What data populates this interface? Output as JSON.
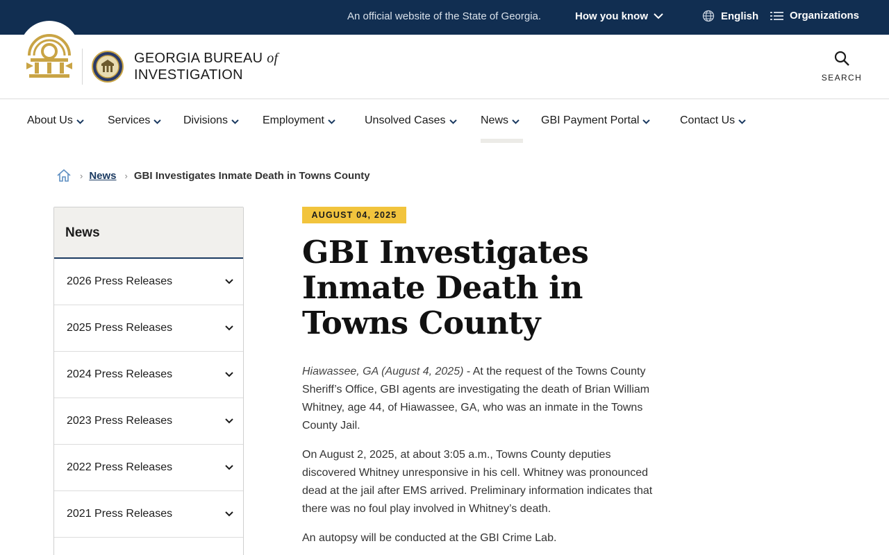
{
  "banner": {
    "official_text": "An official website of the State of Georgia.",
    "how_you_know": "How you know",
    "language": "English",
    "organizations": "Organizations"
  },
  "header": {
    "agency_line1_prefix": "GEORGIA BUREAU",
    "agency_line1_of": "of",
    "agency_line2": "INVESTIGATION",
    "search_label": "SEARCH"
  },
  "nav": {
    "items": [
      {
        "label": "About Us"
      },
      {
        "label": "Services"
      },
      {
        "label": "Divisions"
      },
      {
        "label": "Employment"
      },
      {
        "label": "Unsolved Cases"
      },
      {
        "label": "News"
      },
      {
        "label": "GBI Payment Portal"
      },
      {
        "label": "Contact Us"
      }
    ],
    "active": "News"
  },
  "breadcrumb": {
    "section": "News",
    "current": "GBI Investigates Inmate Death in Towns County"
  },
  "sidebar": {
    "heading": "News",
    "items": [
      {
        "label": "2026 Press Releases"
      },
      {
        "label": "2025 Press Releases"
      },
      {
        "label": "2024 Press Releases"
      },
      {
        "label": "2023 Press Releases"
      },
      {
        "label": "2022 Press Releases"
      },
      {
        "label": "2021 Press Releases"
      }
    ]
  },
  "article": {
    "date": "AUGUST 04, 2025",
    "title": "GBI Investigates Inmate Death in Towns County",
    "dateline": "Hiawassee, GA (August 4, 2025)",
    "p1_rest": " - At the request of the Towns County Sheriff’s Office, GBI agents are investigating the death of Brian William Whitney, age 44, of Hiawassee, GA, who was an inmate in the Towns County Jail.",
    "p2": "On August 2, 2025, at about 3:05 a.m., Towns County deputies discovered Whitney unresponsive in his cell. Whitney was pronounced dead at the jail after EMS arrived. Preliminary information indicates that there was no foul play involved in Whitney’s death.",
    "p3": "An autopsy will be conducted at the GBI Crime Lab."
  },
  "colors": {
    "banner_bg": "#112e51",
    "seal_gold": "#c9a445",
    "date_badge": "#f2c43d",
    "link": "#1b3a61"
  }
}
